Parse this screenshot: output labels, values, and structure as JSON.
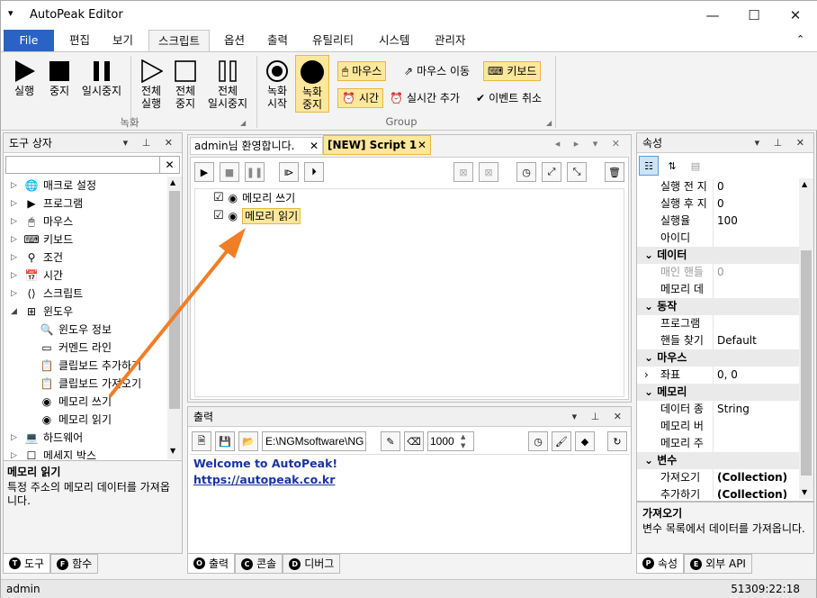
{
  "window": {
    "title": "AutoPeak Editor",
    "menu_glyph": "▾",
    "min": "—",
    "max": "☐",
    "close": "✕"
  },
  "menu_tabs": [
    "File",
    "편집",
    "보기",
    "스크립트",
    "옵션",
    "출력",
    "유틸리티",
    "시스템",
    "관리자"
  ],
  "ribbon": {
    "rec_group": {
      "label": "녹화",
      "buttons": [
        "실행",
        "중지",
        "일시중지",
        "전체\n실행",
        "전체\n중지",
        "전체\n일시중지"
      ]
    },
    "group2": {
      "label": "Group",
      "rec_start": "녹화\n시작",
      "rec_stop": "녹화\n중지",
      "mouse": "마우스",
      "mouse_move": "마우스 이동",
      "keyboard": "키보드",
      "time": "시간",
      "realtime_add": "실시간 추가",
      "event_cancel": "이벤트 취소"
    }
  },
  "toolbox": {
    "title": "도구 상자",
    "search_value": "",
    "items": [
      "매크로 설정",
      "프로그램",
      "마우스",
      "키보드",
      "조건",
      "시간",
      "스크립트",
      "윈도우",
      "윈도우 정보",
      "커멘드 라인",
      "클립보드 추가하기",
      "클립보드 가져오기",
      "메모리 쓰기",
      "메모리 읽기",
      "하드웨어",
      "메세지 박스"
    ],
    "desc_title": "메모리 읽기",
    "desc_text": "특정 주소의 메모리 데이터를 가져옵니다.",
    "tabs": [
      "도구",
      "함수"
    ],
    "tab_letters": [
      "T",
      "F"
    ]
  },
  "doc_tabs": [
    "admin님 환영합니다.",
    "[NEW] Script 1"
  ],
  "script_items": [
    "메모리 쓰기",
    "메모리 읽기"
  ],
  "output": {
    "title": "출력",
    "path": "E:\\NGMsoftware\\NG",
    "number": "1000",
    "welcome": "Welcome to AutoPeak!",
    "link": "https://autopeak.co.kr",
    "tabs": [
      "출력",
      "콘솔",
      "디버그"
    ],
    "tab_letters": [
      "O",
      "C",
      "D"
    ]
  },
  "properties": {
    "title": "속성",
    "rows": [
      {
        "k": "실행 전 지",
        "v": "0"
      },
      {
        "k": "실행 후 지",
        "v": "0"
      },
      {
        "k": "실행율",
        "v": "100"
      },
      {
        "k": "아이디",
        "v": ""
      },
      {
        "cat": "데이터"
      },
      {
        "k": "매인 핸들",
        "v": "0",
        "dim": true
      },
      {
        "k": "메모리 데",
        "v": ""
      },
      {
        "cat": "동작"
      },
      {
        "k": "프로그램",
        "v": ""
      },
      {
        "k": "핸들 찾기",
        "v": "Default"
      },
      {
        "cat": "마우스"
      },
      {
        "k": "좌표",
        "v": "0, 0",
        "exp": true
      },
      {
        "cat": "메모리"
      },
      {
        "k": "데이터 종",
        "v": "String"
      },
      {
        "k": "메모리 버",
        "v": ""
      },
      {
        "k": "메모리 주",
        "v": ""
      },
      {
        "cat": "변수"
      },
      {
        "k": "가져오기",
        "v": "(Collection)",
        "b": true
      },
      {
        "k": "추가하기",
        "v": "(Collection)",
        "b": true
      }
    ],
    "desc_title": "가져오기",
    "desc_text": "변수 목록에서 데이터를 가져옵니다.",
    "tabs": [
      "속성",
      "외부 API"
    ],
    "tab_letters": [
      "P",
      "E"
    ]
  },
  "status": {
    "user": "admin",
    "time": "51309:22:18"
  },
  "colors": {
    "file_tab": "#2b62c5",
    "highlight": "#fde79b",
    "arrow": "#f07e26",
    "link": "#1a34a0"
  }
}
